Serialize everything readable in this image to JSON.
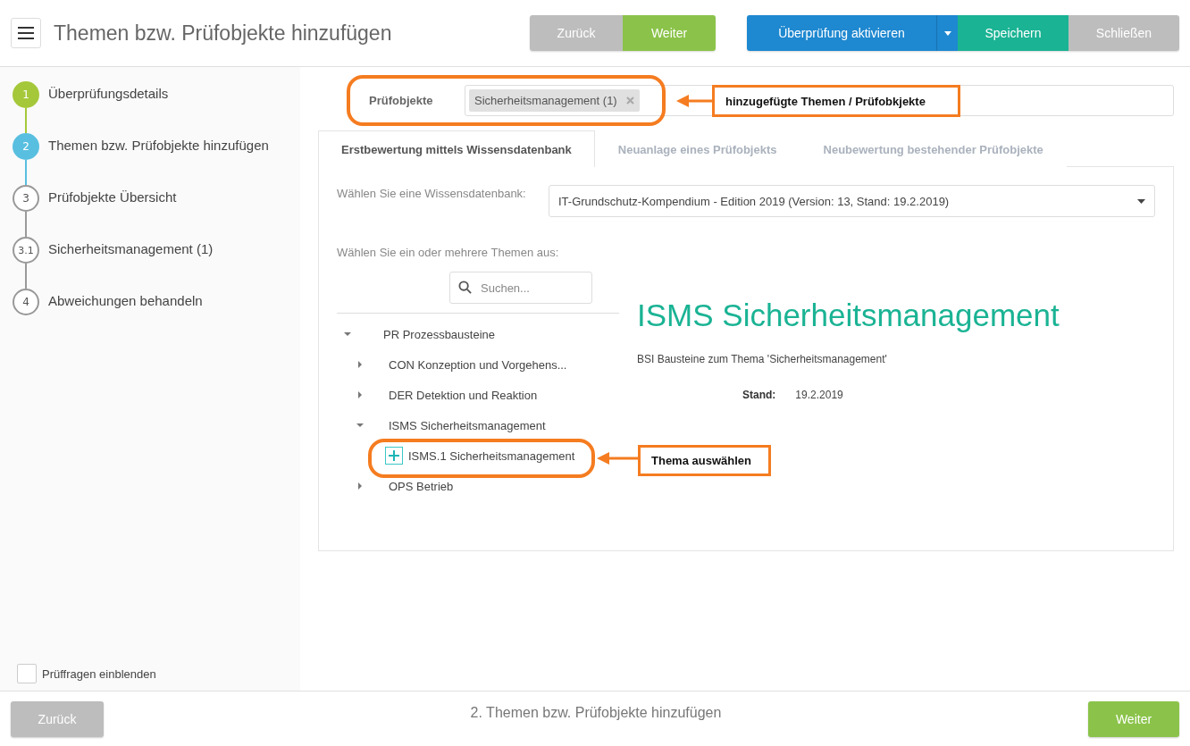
{
  "header": {
    "title": "Themen bzw. Prüfobjekte hinzufügen",
    "nav_buttons": [
      {
        "label": "Zurück",
        "kind": "grey"
      },
      {
        "label": "Weiter",
        "kind": "green"
      }
    ],
    "action_buttons": [
      {
        "label": "Überprüfung aktivieren",
        "kind": "blue"
      },
      {
        "label": "Speichern",
        "kind": "teal"
      },
      {
        "label": "Schließen",
        "kind": "grey"
      }
    ]
  },
  "steps": [
    {
      "number": "1",
      "label": "Überprüfungsdetails",
      "completed": true,
      "selected": false
    },
    {
      "number": "2",
      "label": "Themen bzw. Prüfobjekte hinzufügen",
      "completed": false,
      "selected": true
    },
    {
      "number": "3",
      "label": "Prüfobjekte Übersicht",
      "completed": false,
      "selected": false
    },
    {
      "number": "3.1",
      "label": "Sicherheitsmanagement (1)",
      "completed": false,
      "selected": false
    },
    {
      "number": "4",
      "label": "Abweichungen behandeln",
      "completed": false,
      "selected": false
    }
  ],
  "show_questions": {
    "label": "Prüffragen einblenden",
    "checked": false
  },
  "pruefobjekte": {
    "label": "Prüfobjekte",
    "chips": [
      "Sicherheitsmanagement (1)"
    ]
  },
  "tabs": [
    {
      "label": "Erstbewertung mittels Wissensdatenbank",
      "selected": true
    },
    {
      "label": "Neuanlage eines Prüfobjekts",
      "selected": false
    },
    {
      "label": "Neubewertung bestehender Prüfobjekte",
      "selected": false
    }
  ],
  "knowledge_base": {
    "label": "Wählen Sie eine Wissensdatenbank:",
    "value": "IT-Grundschutz-Kompendium - Edition 2019  (Version: 13, Stand: 19.2.2019)"
  },
  "topics": {
    "label": "Wählen Sie ein oder mehrere Themen aus:",
    "search_placeholder": "Suchen...",
    "tree": [
      {
        "label": "PR Prozessbausteine",
        "kind": "folder",
        "expanded": true,
        "children": [
          {
            "label": "CON Konzeption und Vorgehens...",
            "kind": "folder",
            "expanded": false
          },
          {
            "label": "DER Detektion und Reaktion",
            "kind": "folder",
            "expanded": false
          },
          {
            "label": "ISMS Sicherheitsmanagement",
            "kind": "folder",
            "expanded": true,
            "children": [
              {
                "label": "ISMS.1 Sicherheitsmanagement",
                "kind": "leaf"
              }
            ]
          },
          {
            "label": "OPS Betrieb",
            "kind": "folder",
            "expanded": false
          }
        ]
      }
    ]
  },
  "detail": {
    "title": "ISMS Sicherheitsmanagement",
    "description": "BSI Bausteine zum Thema 'Sicherheitsmanagement'",
    "fields": [
      {
        "label": "Stand:",
        "value": "19.2.2019"
      }
    ]
  },
  "annotations": [
    {
      "text": "hinzugefügte Themen / Prüfobkjekte"
    },
    {
      "text": "Thema auswählen"
    }
  ],
  "footer": {
    "back": "Zurück",
    "step": "2. Themen bzw. Prüfobjekte hinzufügen",
    "next": "Weiter"
  }
}
